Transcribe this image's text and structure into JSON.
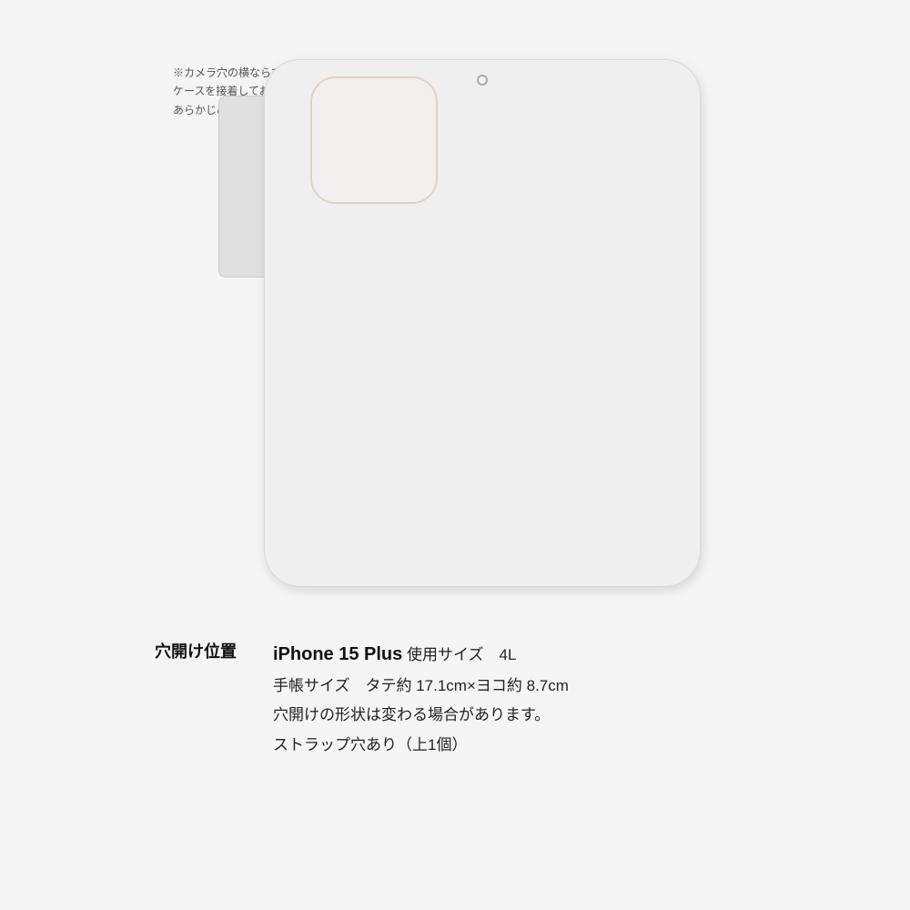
{
  "note": {
    "lines": [
      "※カメラ穴の横ならびに上部は",
      "ケースを接着しておりません。",
      "あらかじめご了承ください。"
    ]
  },
  "hole_label": "穴開け位置",
  "device": {
    "name": "iPhone 15 Plus",
    "size": "使用サイズ　4L",
    "notebook_size": "手帳サイズ　タテ約 17.1cm×ヨコ約 8.7cm",
    "shape_note": "穴開けの形状は変わる場合があります。",
    "strap": "ストラップ穴あり（上1個）"
  }
}
